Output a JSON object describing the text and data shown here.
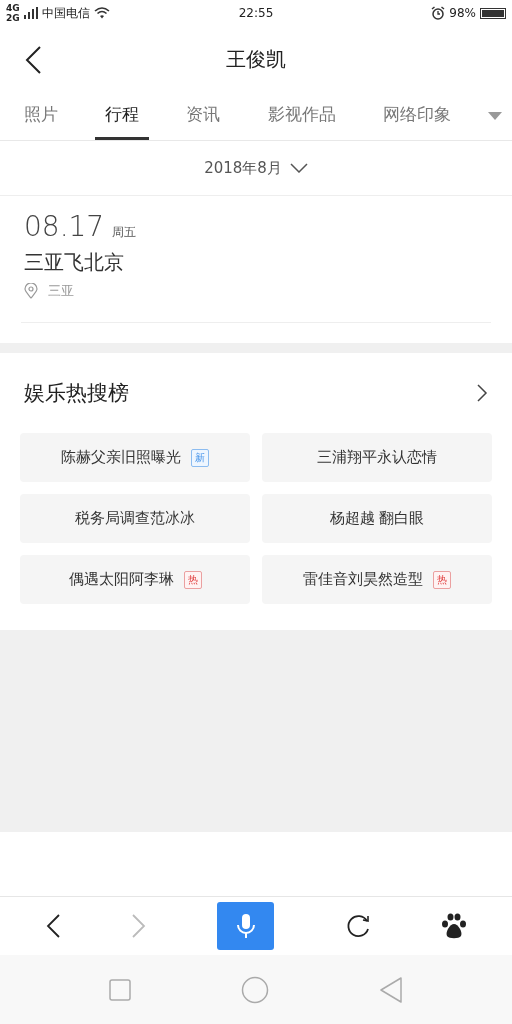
{
  "status_bar": {
    "network": [
      "4G",
      "2G"
    ],
    "carrier": "中国电信",
    "time": "22:55",
    "battery": "98%"
  },
  "header": {
    "title": "王俊凯"
  },
  "tabs": [
    {
      "label": "照片",
      "selected": false
    },
    {
      "label": "行程",
      "selected": true
    },
    {
      "label": "资讯",
      "selected": false
    },
    {
      "label": "影视作品",
      "selected": false
    },
    {
      "label": "网络印象",
      "selected": false
    }
  ],
  "month_picker": {
    "label": "2018年8月"
  },
  "itinerary": [
    {
      "date": "08.17",
      "weekday": "周五",
      "title": "三亚飞北京",
      "location": "三亚"
    }
  ],
  "hot_search": {
    "title": "娱乐热搜榜",
    "items": [
      {
        "text": "陈赫父亲旧照曝光",
        "badge": "新",
        "kind": "new"
      },
      {
        "text": "三浦翔平永认恋情"
      },
      {
        "text": "税务局调查范冰冰"
      },
      {
        "text": "杨超越 翻白眼"
      },
      {
        "text": "偶遇太阳阿李琳",
        "badge": "热",
        "kind": "hot"
      },
      {
        "text": "雷佳音刘昊然造型",
        "badge": "热",
        "kind": "hot"
      }
    ]
  },
  "browser_toolbar": {
    "forward_disabled": true
  }
}
